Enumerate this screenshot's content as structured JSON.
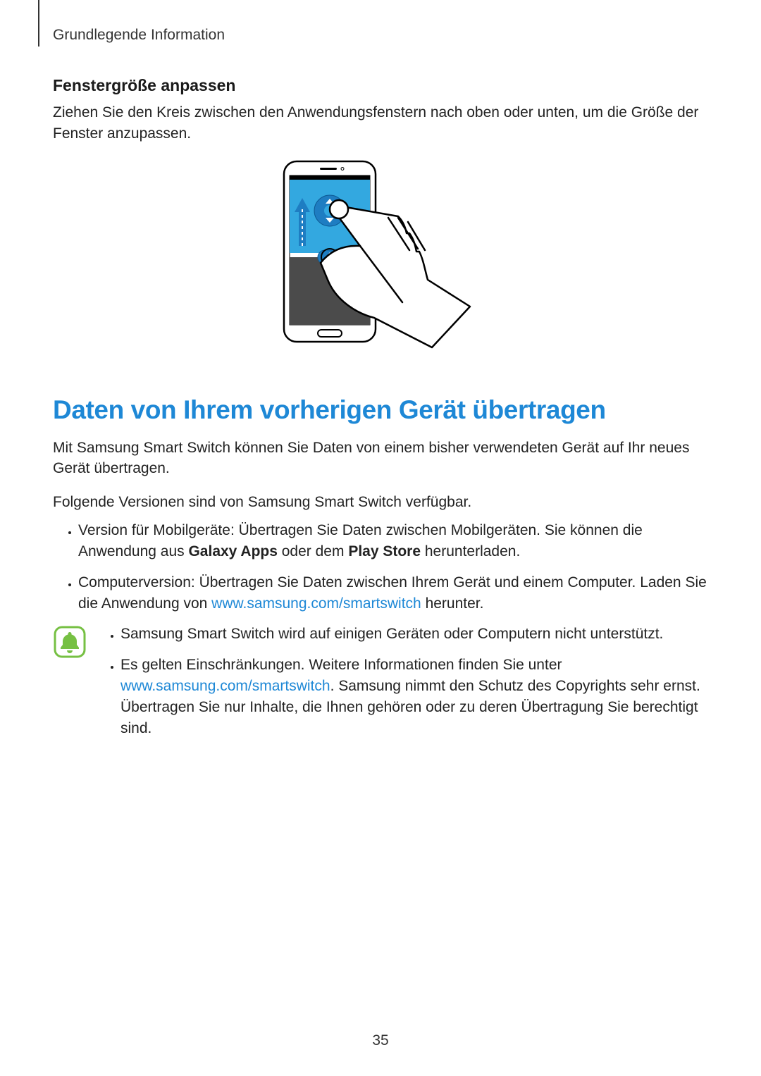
{
  "header": {
    "section_label": "Grundlegende Information"
  },
  "section1": {
    "heading": "Fenstergröße anpassen",
    "body": "Ziehen Sie den Kreis zwischen den Anwendungsfenstern nach oben oder unten, um die Größe der Fenster anzupassen."
  },
  "section2": {
    "heading": "Daten von Ihrem vorherigen Gerät übertragen",
    "intro1": "Mit Samsung Smart Switch können Sie Daten von einem bisher verwendeten Gerät auf Ihr neues Gerät übertragen.",
    "intro2": "Folgende Versionen sind von Samsung Smart Switch verfügbar.",
    "bullets": {
      "b1_pre": "Version für Mobilgeräte: Übertragen Sie Daten zwischen Mobilgeräten. Sie können die Anwendung aus ",
      "b1_bold1": "Galaxy Apps",
      "b1_mid": " oder dem ",
      "b1_bold2": "Play Store",
      "b1_post": " herunterladen.",
      "b2_pre": "Computerversion: Übertragen Sie Daten zwischen Ihrem Gerät und einem Computer. Laden Sie die Anwendung von ",
      "b2_link": "www.samsung.com/smartswitch",
      "b2_post": " herunter."
    },
    "note": {
      "n1": "Samsung Smart Switch wird auf einigen Geräten oder Computern nicht unterstützt.",
      "n2_pre": "Es gelten Einschränkungen. Weitere Informationen finden Sie unter ",
      "n2_link": "www.samsung.com/smartswitch",
      "n2_post": ". Samsung nimmt den Schutz des Copyrights sehr ernst. Übertragen Sie nur Inhalte, die Ihnen gehören oder zu deren Übertragung Sie berechtigt sind."
    }
  },
  "page_number": "35"
}
